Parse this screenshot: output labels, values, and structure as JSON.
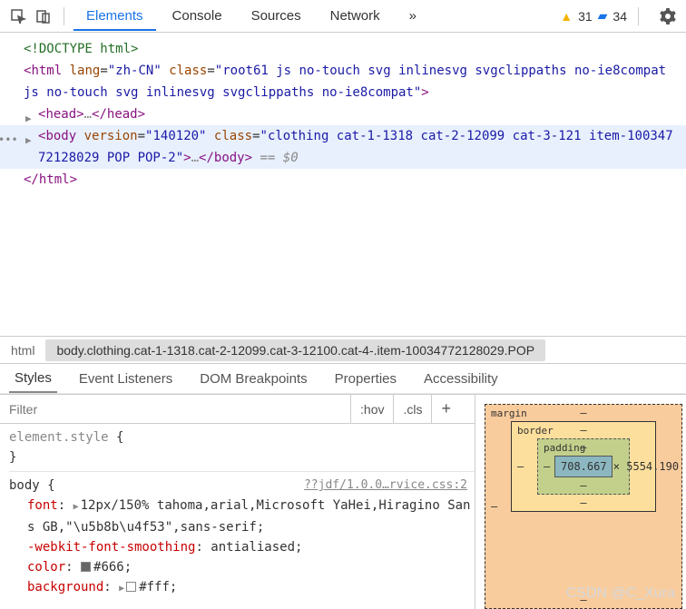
{
  "toolbar": {
    "tabs": [
      "Elements",
      "Console",
      "Sources",
      "Network"
    ],
    "active_tab": 0,
    "warnings": "31",
    "messages": "34"
  },
  "dom": {
    "doctype": "<!DOCTYPE html>",
    "html_open": "html",
    "html_lang_attr": "lang",
    "html_lang_val": "\"zh-CN\"",
    "html_class_attr": "class",
    "html_class_val": "\"root61 js no-touch svg inlinesvg svgclippaths no-ie8compat js no-touch svg inlinesvg svgclippaths no-ie8compat\"",
    "head_open": "head",
    "head_close": "head",
    "body_open": "body",
    "body_version_attr": "version",
    "body_version_val": "\"140120\"",
    "body_class_attr": "class",
    "body_class_val": "\"clothing cat-1-1318 cat-2-12099 cat-3-121 item-10034772128029 POP POP-2\"",
    "body_close": "body",
    "body_eq": "== $0",
    "html_close": "html"
  },
  "breadcrumb": {
    "first": "html",
    "second": "body.clothing.cat-1-1318.cat-2-12099.cat-3-12100.cat-4-.item-10034772128029.POP"
  },
  "subtabs": [
    "Styles",
    "Event Listeners",
    "DOM Breakpoints",
    "Properties",
    "Accessibility"
  ],
  "styles": {
    "filter_placeholder": "Filter",
    "hov": ":hov",
    "cls": ".cls",
    "rule0_selector": "element.style",
    "rule1_selector": "body",
    "rule1_src": "??jdf/1.0.0…rvice.css:2",
    "font_name": "font",
    "font_val": "12px/150% tahoma,arial,Microsoft YaHei,Hiragino Sans GB,\"\\u5b8b\\u4f53\",sans-serif;",
    "smoothing_name": "-webkit-font-smoothing",
    "smoothing_val": "antialiased;",
    "color_name": "color",
    "color_swatch": "#666666",
    "color_val": "#666;",
    "bg_name": "background",
    "bg_swatch": "#ffffff",
    "bg_val": "#fff;"
  },
  "boxmodel": {
    "margin_label": "margin",
    "border_label": "border",
    "padding_label": "padding",
    "content": "708.667 × 5554.190",
    "dash": "–"
  },
  "watermark": "CSDN @C_Xura"
}
